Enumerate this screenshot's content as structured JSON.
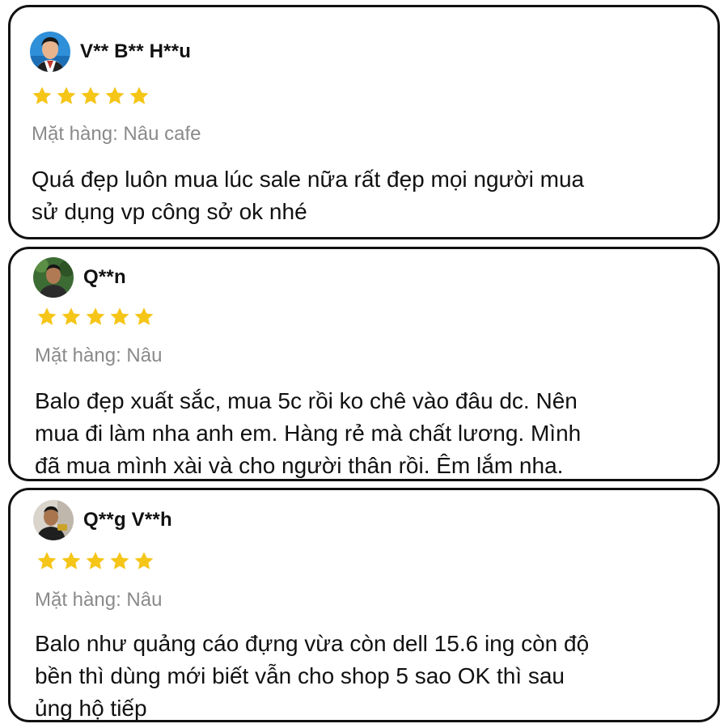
{
  "colors": {
    "star": "#f5c518",
    "variant_text": "#8a8a8a",
    "border": "#111111"
  },
  "reviews": [
    {
      "username": "V** B** H**u",
      "rating": 5,
      "variant": "Mặt hàng: Nâu cafe",
      "lines": [
        "Quá đẹp luôn mua lúc sale nữa rất đẹp mọi người mua",
        "sử dụng vp công sở ok nhé"
      ],
      "avatar_icon": "user-avatar-icon"
    },
    {
      "username": "Q**n",
      "rating": 5,
      "variant": "Mặt hàng: Nâu",
      "lines": [
        "Balo đẹp xuất sắc, mua 5c rồi ko chê vào đâu dc. Nên",
        "mua đi làm nha anh em. Hàng rẻ mà chất lương. Mình",
        "đã mua mình xài và cho người thân rồi. Êm lắm nha."
      ],
      "avatar_icon": "user-avatar-icon"
    },
    {
      "username": "Q**g V**h",
      "rating": 5,
      "variant": "Mặt hàng: Nâu",
      "lines": [
        "Balo như quảng cáo đựng vừa còn dell 15.6 ing còn độ",
        "bền thì dùng mới biết vẫn cho shop 5 sao OK thì sau",
        "ủng hộ tiếp"
      ],
      "avatar_icon": "user-avatar-icon"
    }
  ]
}
